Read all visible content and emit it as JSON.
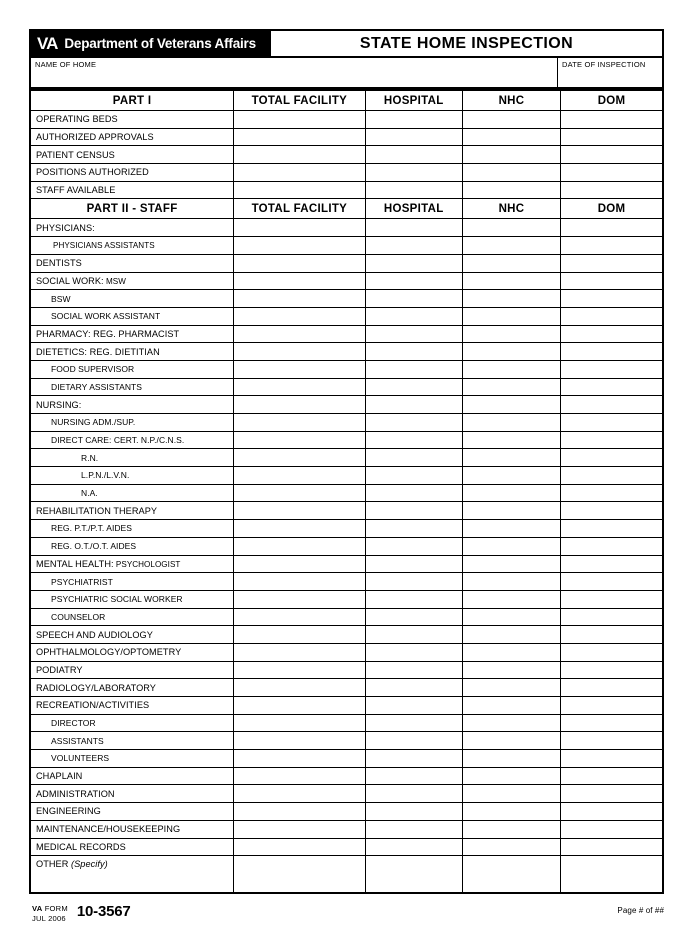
{
  "header": {
    "va_logo_text": "VA",
    "department": "Department of Veterans Affairs",
    "title": "STATE HOME INSPECTION",
    "name_of_home_label": "NAME OF HOME",
    "name_of_home_value": "",
    "date_of_inspection_label": "DATE OF INSPECTION",
    "date_of_inspection_value": ""
  },
  "columns": {
    "label": "",
    "total_facility": "TOTAL FACILITY",
    "hospital": "HOSPITAL",
    "nhc": "NHC",
    "dom": "DOM"
  },
  "part1": {
    "heading": "PART I",
    "rows": [
      {
        "label": "OPERATING BEDS",
        "indent": 0,
        "total_facility": "",
        "hospital": "",
        "nhc": "",
        "dom": ""
      },
      {
        "label": "AUTHORIZED APPROVALS",
        "indent": 0,
        "total_facility": "",
        "hospital": "",
        "nhc": "",
        "dom": ""
      },
      {
        "label": "PATIENT CENSUS",
        "indent": 0,
        "total_facility": "",
        "hospital": "",
        "nhc": "",
        "dom": ""
      },
      {
        "label": "POSITIONS AUTHORIZED",
        "indent": 0,
        "total_facility": "",
        "hospital": "",
        "nhc": "",
        "dom": ""
      },
      {
        "label": "STAFF AVAILABLE",
        "indent": 0,
        "total_facility": "",
        "hospital": "",
        "nhc": "",
        "dom": ""
      }
    ]
  },
  "part2": {
    "heading": "PART II - STAFF",
    "rows": [
      {
        "label": "PHYSICIANS:",
        "indent": 0,
        "total_facility": "",
        "hospital": "",
        "nhc": "",
        "dom": ""
      },
      {
        "label": "PHYSICIANS ASSISTANTS",
        "indent": 1,
        "total_facility": "",
        "hospital": "",
        "nhc": "",
        "dom": ""
      },
      {
        "label": "DENTISTS",
        "indent": 0,
        "total_facility": "",
        "hospital": "",
        "nhc": "",
        "dom": ""
      },
      {
        "label": "SOCIAL WORK:",
        "suffix": "MSW",
        "indent": 0,
        "total_facility": "",
        "hospital": "",
        "nhc": "",
        "dom": ""
      },
      {
        "label": "BSW",
        "indent": 2,
        "total_facility": "",
        "hospital": "",
        "nhc": "",
        "dom": ""
      },
      {
        "label": "SOCIAL WORK ASSISTANT",
        "indent": 2,
        "total_facility": "",
        "hospital": "",
        "nhc": "",
        "dom": ""
      },
      {
        "label": "PHARMACY: REG. PHARMACIST",
        "indent": 0,
        "total_facility": "",
        "hospital": "",
        "nhc": "",
        "dom": ""
      },
      {
        "label": "DIETETICS: REG. DIETITIAN",
        "indent": 0,
        "total_facility": "",
        "hospital": "",
        "nhc": "",
        "dom": ""
      },
      {
        "label": "FOOD SUPERVISOR",
        "indent": 2,
        "total_facility": "",
        "hospital": "",
        "nhc": "",
        "dom": ""
      },
      {
        "label": "DIETARY ASSISTANTS",
        "indent": 2,
        "total_facility": "",
        "hospital": "",
        "nhc": "",
        "dom": ""
      },
      {
        "label": "NURSING:",
        "indent": 0,
        "total_facility": "",
        "hospital": "",
        "nhc": "",
        "dom": ""
      },
      {
        "label": "NURSING ADM./SUP.",
        "indent": 2,
        "total_facility": "",
        "hospital": "",
        "nhc": "",
        "dom": ""
      },
      {
        "label": "DIRECT CARE: CERT. N.P./C.N.S.",
        "indent": 2,
        "total_facility": "",
        "hospital": "",
        "nhc": "",
        "dom": ""
      },
      {
        "label": "R.N.",
        "indent": 3,
        "total_facility": "",
        "hospital": "",
        "nhc": "",
        "dom": ""
      },
      {
        "label": "L.P.N./L.V.N.",
        "indent": 3,
        "total_facility": "",
        "hospital": "",
        "nhc": "",
        "dom": ""
      },
      {
        "label": "N.A.",
        "indent": 3,
        "total_facility": "",
        "hospital": "",
        "nhc": "",
        "dom": ""
      },
      {
        "label": "REHABILITATION THERAPY",
        "indent": 0,
        "total_facility": "",
        "hospital": "",
        "nhc": "",
        "dom": ""
      },
      {
        "label": "REG. P.T./P.T. AIDES",
        "indent": 2,
        "total_facility": "",
        "hospital": "",
        "nhc": "",
        "dom": ""
      },
      {
        "label": "REG. O.T./O.T. AIDES",
        "indent": 2,
        "total_facility": "",
        "hospital": "",
        "nhc": "",
        "dom": ""
      },
      {
        "label": "MENTAL HEALTH:",
        "suffix": "PSYCHOLOGIST",
        "indent": 0,
        "total_facility": "",
        "hospital": "",
        "nhc": "",
        "dom": ""
      },
      {
        "label": "PSYCHIATRIST",
        "indent": 2,
        "total_facility": "",
        "hospital": "",
        "nhc": "",
        "dom": ""
      },
      {
        "label": "PSYCHIATRIC SOCIAL WORKER",
        "indent": 2,
        "total_facility": "",
        "hospital": "",
        "nhc": "",
        "dom": ""
      },
      {
        "label": "COUNSELOR",
        "indent": 2,
        "total_facility": "",
        "hospital": "",
        "nhc": "",
        "dom": ""
      },
      {
        "label": "SPEECH AND AUDIOLOGY",
        "indent": 0,
        "total_facility": "",
        "hospital": "",
        "nhc": "",
        "dom": ""
      },
      {
        "label": "OPHTHALMOLOGY/OPTOMETRY",
        "indent": 0,
        "total_facility": "",
        "hospital": "",
        "nhc": "",
        "dom": ""
      },
      {
        "label": "PODIATRY",
        "indent": 0,
        "total_facility": "",
        "hospital": "",
        "nhc": "",
        "dom": ""
      },
      {
        "label": "RADIOLOGY/LABORATORY",
        "indent": 0,
        "total_facility": "",
        "hospital": "",
        "nhc": "",
        "dom": ""
      },
      {
        "label": "RECREATION/ACTIVITIES",
        "indent": 0,
        "total_facility": "",
        "hospital": "",
        "nhc": "",
        "dom": ""
      },
      {
        "label": "DIRECTOR",
        "indent": 2,
        "total_facility": "",
        "hospital": "",
        "nhc": "",
        "dom": ""
      },
      {
        "label": "ASSISTANTS",
        "indent": 2,
        "total_facility": "",
        "hospital": "",
        "nhc": "",
        "dom": ""
      },
      {
        "label": "VOLUNTEERS",
        "indent": 2,
        "total_facility": "",
        "hospital": "",
        "nhc": "",
        "dom": ""
      },
      {
        "label": "CHAPLAIN",
        "indent": 0,
        "total_facility": "",
        "hospital": "",
        "nhc": "",
        "dom": ""
      },
      {
        "label": "ADMINISTRATION",
        "indent": 0,
        "total_facility": "",
        "hospital": "",
        "nhc": "",
        "dom": ""
      },
      {
        "label": "ENGINEERING",
        "indent": 0,
        "total_facility": "",
        "hospital": "",
        "nhc": "",
        "dom": ""
      },
      {
        "label": "MAINTENANCE/HOUSEKEEPING",
        "indent": 0,
        "total_facility": "",
        "hospital": "",
        "nhc": "",
        "dom": ""
      },
      {
        "label": "MEDICAL RECORDS",
        "indent": 0,
        "total_facility": "",
        "hospital": "",
        "nhc": "",
        "dom": ""
      },
      {
        "label": "OTHER",
        "italic_suffix": "(Specify)",
        "indent": 0,
        "tall": true,
        "total_facility": "",
        "hospital": "",
        "nhc": "",
        "dom": ""
      }
    ]
  },
  "footer": {
    "va_label_bold": "VA",
    "va_label_rest": " FORM",
    "form_date": "JUL 2006",
    "form_number": "10-3567",
    "page_number": "Page # of ##"
  }
}
